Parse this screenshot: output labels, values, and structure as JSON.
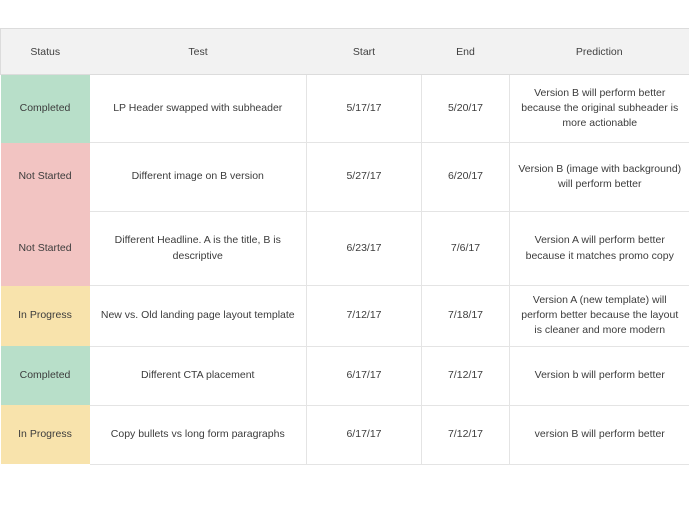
{
  "table": {
    "columns": [
      {
        "key": "status",
        "label": "Status"
      },
      {
        "key": "test",
        "label": "Test"
      },
      {
        "key": "start",
        "label": "Start"
      },
      {
        "key": "end",
        "label": "End"
      },
      {
        "key": "prediction",
        "label": "Prediction"
      }
    ],
    "status_colors": {
      "Completed": "#b8dfc9",
      "Not Started": "#f2c4c2",
      "In Progress": "#f8e3ac"
    },
    "rows": [
      {
        "status": "Completed",
        "test": "LP Header swapped with subheader",
        "start": "5/17/17",
        "end": "5/20/17",
        "prediction": "Version B will perform better because the original subheader is more actionable"
      },
      {
        "status": "Not Started",
        "test": "Different image on B version",
        "start": "5/27/17",
        "end": "6/20/17",
        "prediction": "Version B (image with background) will perform better"
      },
      {
        "status": "Not Started",
        "test": "Different Headline. A is the title, B is descriptive",
        "start": "6/23/17",
        "end": "7/6/17",
        "prediction": "Version A will perform better because it matches promo copy"
      },
      {
        "status": "In Progress",
        "test": "New vs. Old landing page layout template",
        "start": "7/12/17",
        "end": "7/18/17",
        "prediction": "Version A (new template) will perform better because the layout is cleaner and more modern"
      },
      {
        "status": "Completed",
        "test": "Different CTA placement",
        "start": "6/17/17",
        "end": "7/12/17",
        "prediction": "Version b will perform better"
      },
      {
        "status": "In Progress",
        "test": "Copy bullets vs long form paragraphs",
        "start": "6/17/17",
        "end": "7/12/17",
        "prediction": "version B will perform better"
      }
    ]
  }
}
